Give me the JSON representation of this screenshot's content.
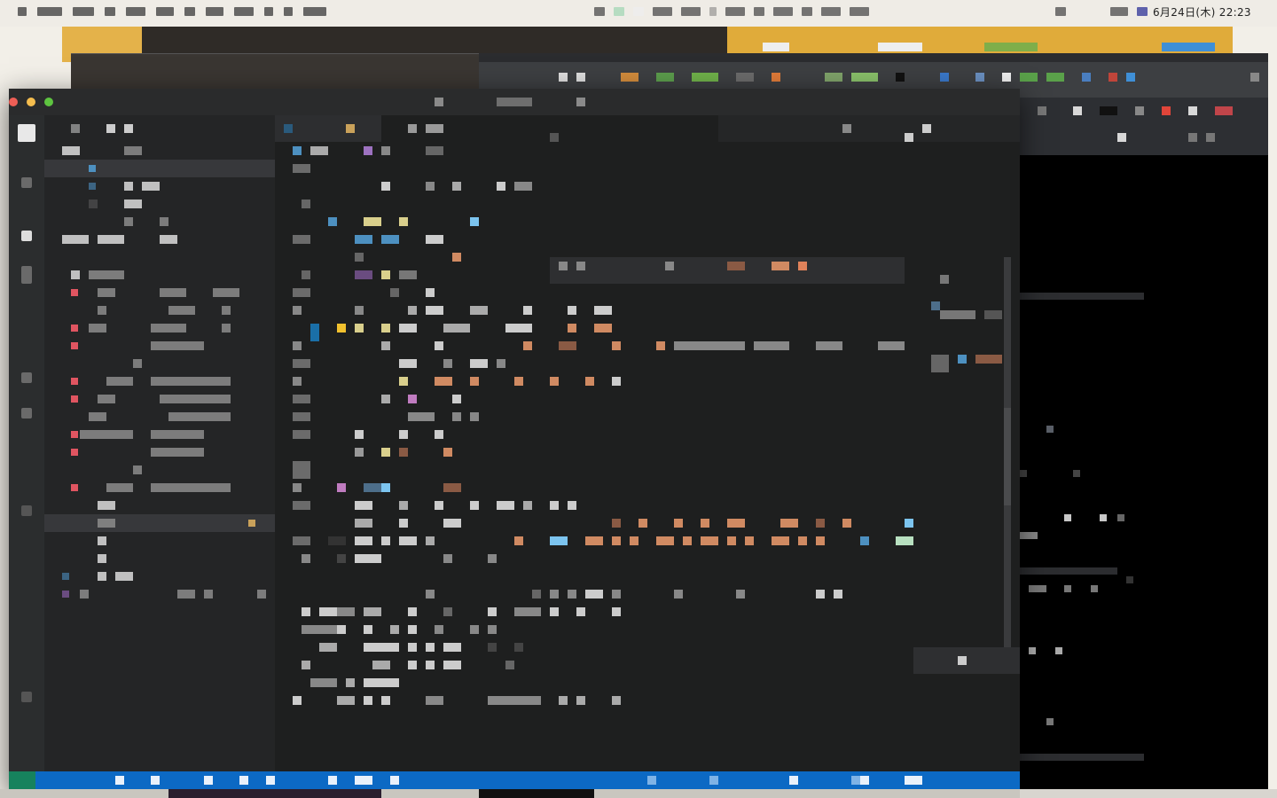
{
  "menubar": {
    "datetime": "6月24日(木)  22:23"
  },
  "colors": {
    "editor_bg": "#1e1f1f",
    "sidebar_bg": "#242526",
    "statusbar": "#0c69c4",
    "remote_indicator": "#16825d",
    "git_modified_marker": "#e05561",
    "accent_yellow": "#c9a15a",
    "token_orange": "#d08a62",
    "token_blue": "#4d90c0",
    "token_lightblue": "#7cc4ef",
    "token_purple": "#9d72c0",
    "token_yellow": "#d9cf8c"
  },
  "icons": {
    "activity": [
      "explorer-icon",
      "search-icon",
      "source-control-icon",
      "run-debug-icon",
      "extensions-icon",
      "remote-explorer-icon",
      "account-icon",
      "settings-gear-icon"
    ],
    "window_controls": [
      "close-icon",
      "minimize-icon",
      "zoom-icon"
    ]
  }
}
